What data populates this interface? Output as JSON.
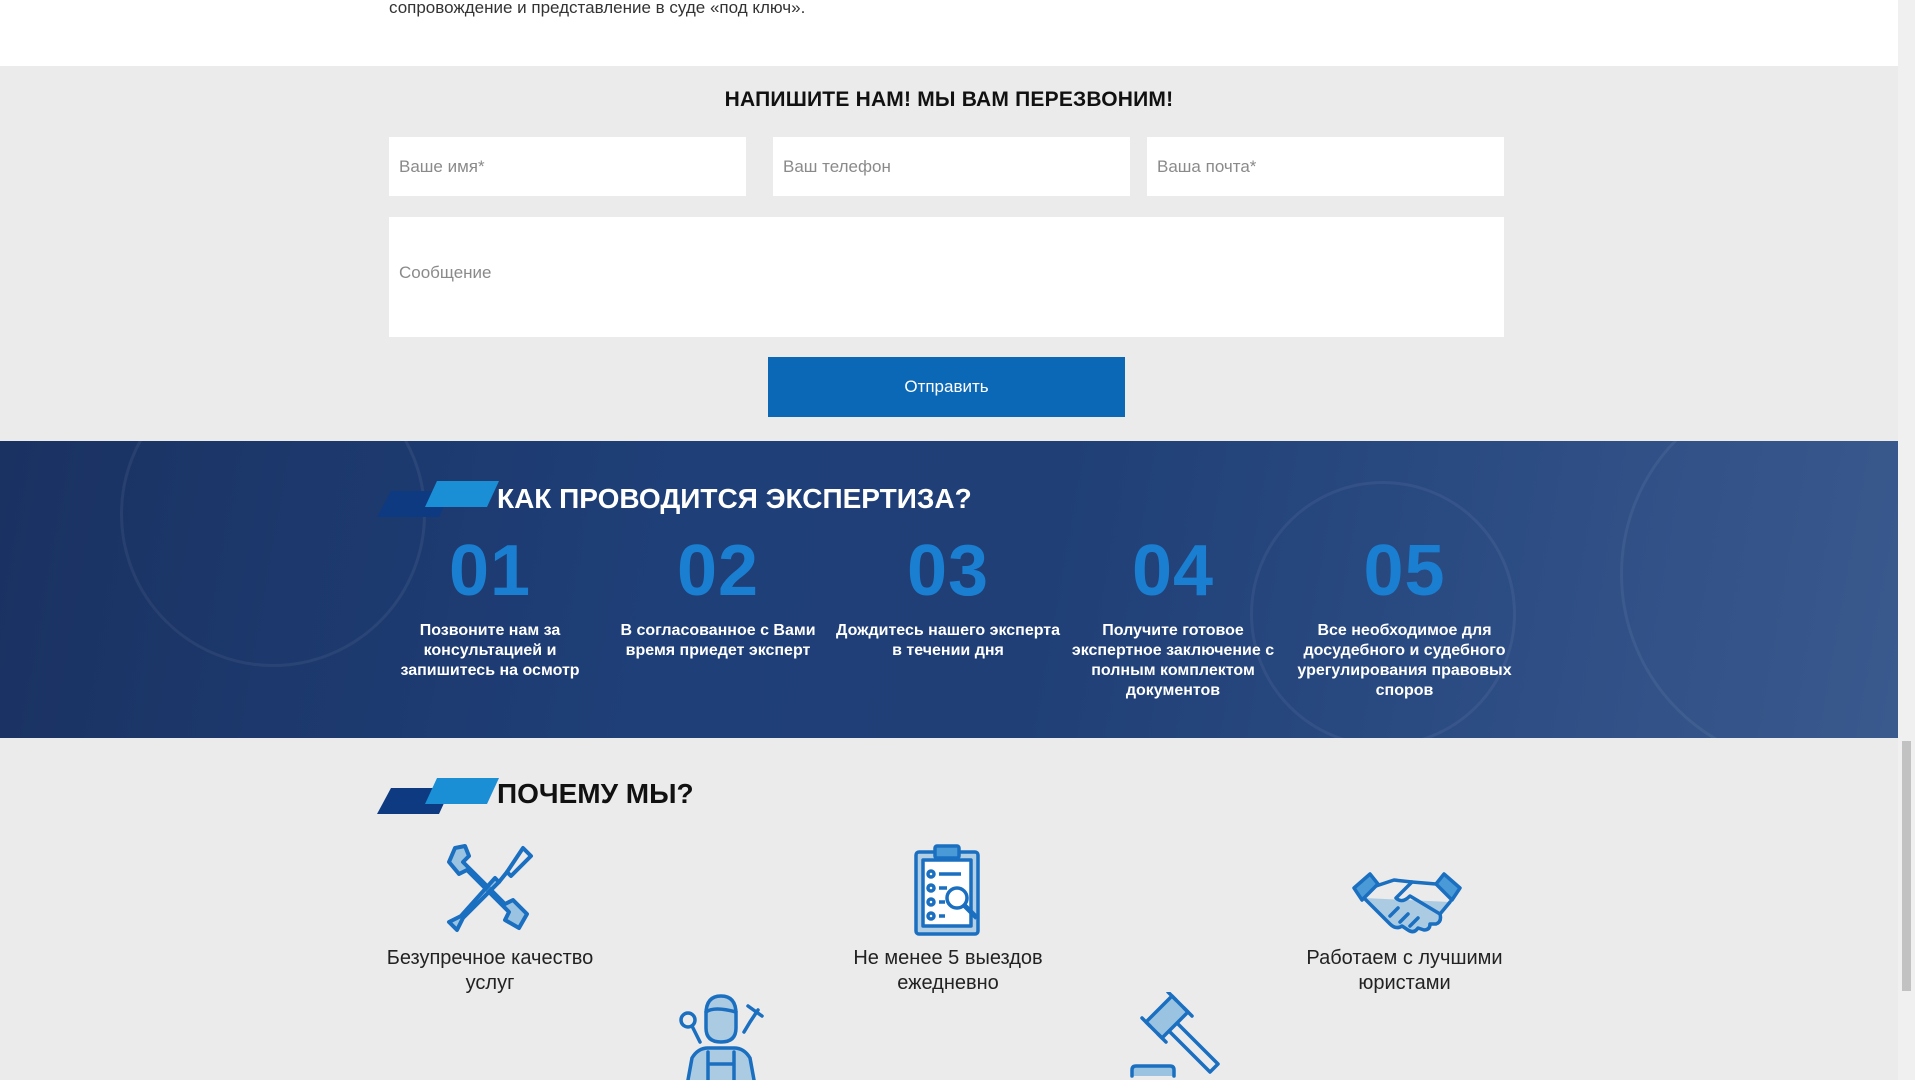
{
  "top": {
    "text": "сопровождение и представление в суде «под ключ»."
  },
  "form": {
    "title": "НАПИШИТЕ НАМ! МЫ ВАМ ПЕРЕЗВОНИМ!",
    "name_placeholder": "Ваше имя*",
    "phone_placeholder": "Ваш телефон",
    "email_placeholder": "Ваша почта*",
    "message_placeholder": "Сообщение",
    "submit_label": "Отправить"
  },
  "steps": {
    "heading": "КАК ПРОВОДИТСЯ ЭКСПЕРТИЗА?",
    "items": [
      {
        "num": "01",
        "text": "Позвоните нам за консультацией и запишитесь на осмотр"
      },
      {
        "num": "02",
        "text": "В согласованное с Вами время приедет эксперт"
      },
      {
        "num": "03",
        "text": "Дождитесь нашего эксперта в течении дня"
      },
      {
        "num": "04",
        "text": "Получите готовое экспертное заключение с полным комплектом документов"
      },
      {
        "num": "05",
        "text": "Все необходимое для досудебного и судебного урегулирования правовых споров"
      }
    ]
  },
  "why": {
    "heading": "ПОЧЕМУ МЫ?",
    "items": [
      {
        "icon": "tools-icon",
        "text": "Безупречное качество услуг"
      },
      {
        "icon": "clipboard-search-icon",
        "text": "Не менее 5 выездов ежедневно"
      },
      {
        "icon": "handshake-icon",
        "text": "Работаем с лучшими юристами"
      },
      {
        "icon": "mechanic-icon",
        "text": ""
      },
      {
        "icon": "gavel-icon",
        "text": ""
      }
    ]
  },
  "colors": {
    "accent_blue": "#0a68b6",
    "step_number": "#1a7fd0",
    "dark_section": "#1f3f78",
    "icon_blue": "#1a6fc0"
  }
}
